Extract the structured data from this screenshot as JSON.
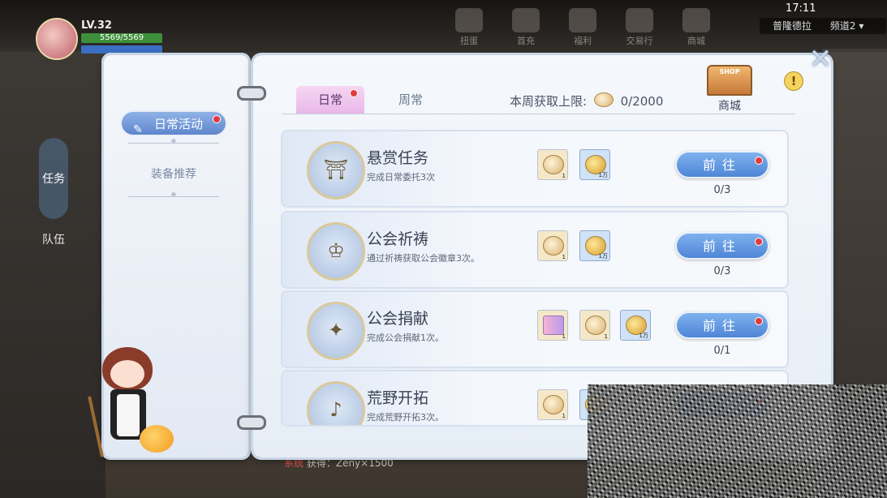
{
  "hud": {
    "level": "LV.32",
    "hp": "5569/5569",
    "time": "17:11",
    "server": "普隆德拉",
    "channel": "频道2",
    "top_icons": [
      "扭蛋",
      "首充",
      "福利",
      "交易行",
      "商城"
    ],
    "left_side": [
      "任务",
      "队伍"
    ],
    "chat_system": "系统",
    "chat_message": "获得：Zeny×1500"
  },
  "sidebar": {
    "items": [
      {
        "label": "日常活动",
        "active": true,
        "has_dot": true
      },
      {
        "label": "装备推荐",
        "active": false,
        "has_dot": false
      }
    ]
  },
  "tabs": [
    {
      "label": "日常",
      "active": true,
      "has_dot": true
    },
    {
      "label": "周常",
      "active": false,
      "has_dot": false
    }
  ],
  "weekly_limit": {
    "label": "本周获取上限:",
    "value": "0/2000"
  },
  "shop": {
    "sign": "SHOP",
    "label": "商城"
  },
  "help_icon": "!",
  "go_label": "前往",
  "tasks": [
    {
      "name": "悬赏任务",
      "desc": "完成日常委托3次",
      "emblem": "bulletin-board",
      "rewards": [
        {
          "type": "ticket-coin",
          "count": "1"
        },
        {
          "type": "gold-coin",
          "count": "1万"
        }
      ],
      "progress": "0/3"
    },
    {
      "name": "公会祈祷",
      "desc": "通过祈祷获取公会徽章3次。",
      "emblem": "guild-crest",
      "rewards": [
        {
          "type": "ticket-coin",
          "count": "1"
        },
        {
          "type": "gold-coin",
          "count": "1万"
        }
      ],
      "progress": "0/3"
    },
    {
      "name": "公会捐献",
      "desc": "完成公会捐献1次。",
      "emblem": "donation",
      "rewards": [
        {
          "type": "ticket",
          "count": "1"
        },
        {
          "type": "ticket-coin",
          "count": "1"
        },
        {
          "type": "gold-coin",
          "count": "1万"
        }
      ],
      "progress": "0/1"
    },
    {
      "name": "荒野开拓",
      "desc": "完成荒野开拓3次。",
      "emblem": "horn",
      "rewards": [
        {
          "type": "ticket-coin",
          "count": "1"
        },
        {
          "type": "gold-coin",
          "count": "1万"
        }
      ],
      "progress": ""
    }
  ]
}
